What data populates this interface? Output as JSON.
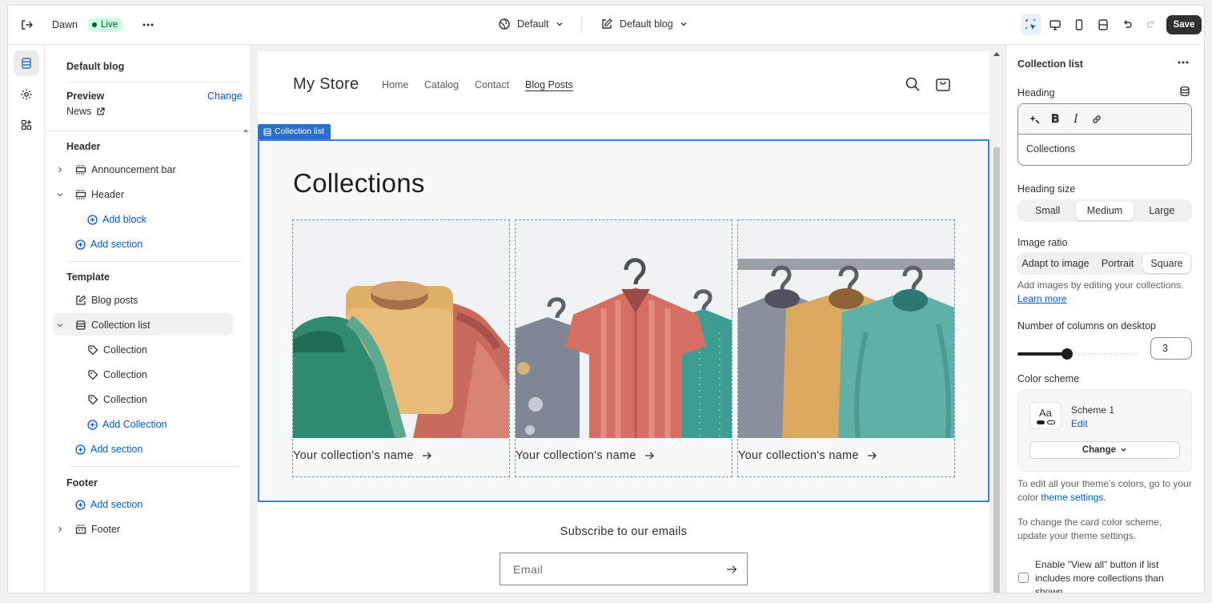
{
  "topbar": {
    "theme_name": "Dawn",
    "live_badge": "Live",
    "template_selector": "Default",
    "page_selector": "Default blog",
    "save_label": "Save"
  },
  "left_panel": {
    "title": "Default blog",
    "preview_label": "Preview",
    "change_link": "Change",
    "preview_value": "News",
    "header_group": "Header",
    "announcement_bar": "Announcement bar",
    "header_section": "Header",
    "add_block": "Add block",
    "add_section_header": "Add section",
    "template_group": "Template",
    "blog_posts": "Blog posts",
    "collection_list": "Collection list",
    "collections": [
      "Collection",
      "Collection",
      "Collection"
    ],
    "add_collection": "Add Collection",
    "add_section_template": "Add section",
    "footer_group": "Footer",
    "add_section_footer": "Add section",
    "footer_section": "Footer"
  },
  "store": {
    "name": "My Store",
    "nav": [
      "Home",
      "Catalog",
      "Contact",
      "Blog Posts"
    ],
    "section_tag": "Collection list",
    "collections_heading": "Collections",
    "card_name": "Your collection's name",
    "subscribe_heading": "Subscribe to our emails",
    "email_placeholder": "Email"
  },
  "right_panel": {
    "title": "Collection list",
    "heading_label": "Heading",
    "heading_value": "Collections",
    "heading_size_label": "Heading size",
    "heading_size_options": [
      "Small",
      "Medium",
      "Large"
    ],
    "heading_size_selected": "Medium",
    "image_ratio_label": "Image ratio",
    "image_ratio_options": [
      "Adapt to image",
      "Portrait",
      "Square"
    ],
    "image_ratio_selected": "Square",
    "image_help": "Add images by editing your collections.",
    "learn_more": "Learn more",
    "columns_label": "Number of columns on desktop",
    "columns_value": "3",
    "color_scheme_label": "Color scheme",
    "scheme_swatch_text": "Aa",
    "scheme_name": "Scheme 1",
    "scheme_edit": "Edit",
    "scheme_change": "Change",
    "colors_help_1": "To edit all your theme's colors, go to your color",
    "colors_help_link": "theme settings.",
    "card_scheme_help": "To change the card color scheme, update your theme settings.",
    "view_all_label": "Enable \"View all\" button if list includes more collections than shown"
  },
  "colors": {
    "accent_link": "#005bd3",
    "selection_blue": "#3b82e0",
    "live_bg": "#cdfee1",
    "save_bg": "#303030"
  }
}
